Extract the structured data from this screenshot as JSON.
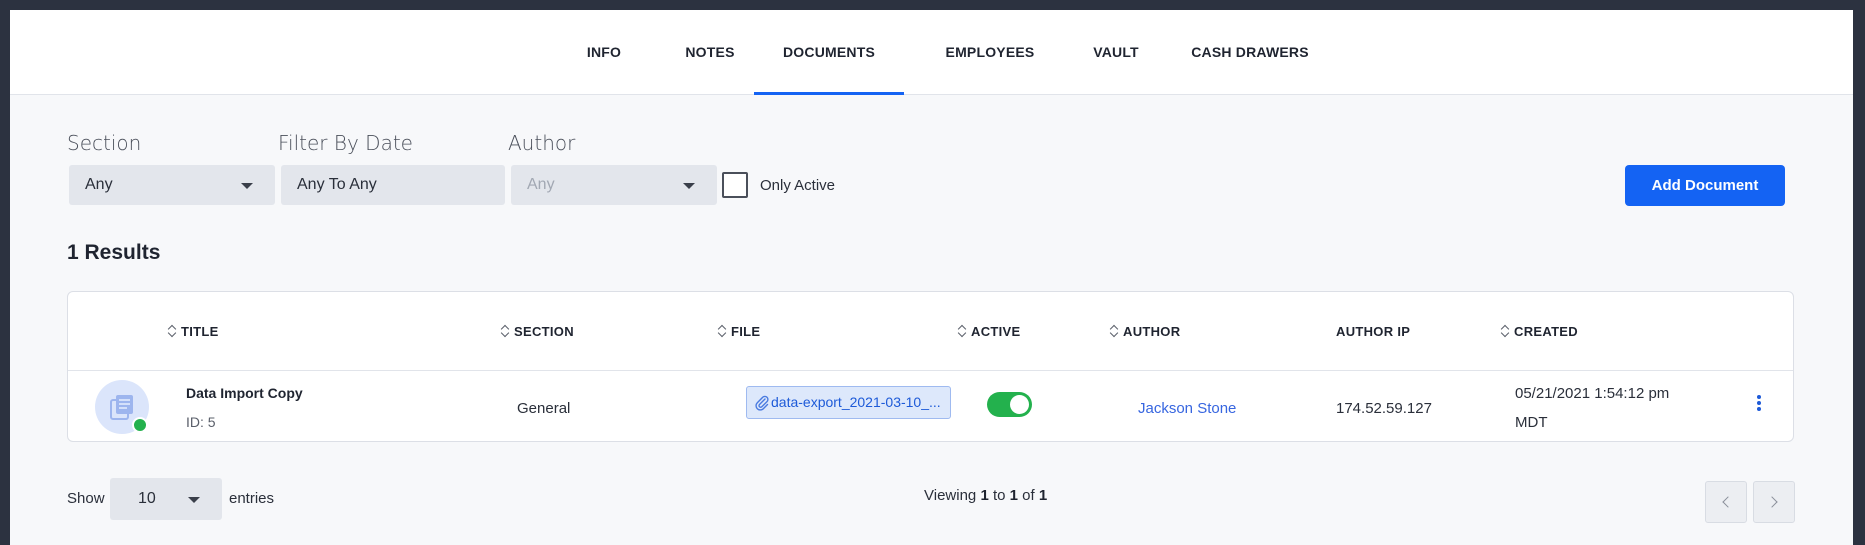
{
  "tabs": [
    {
      "label": "INFO",
      "active": false
    },
    {
      "label": "NOTES",
      "active": false
    },
    {
      "label": "DOCUMENTS",
      "active": true
    },
    {
      "label": "EMPLOYEES",
      "active": false
    },
    {
      "label": "VAULT",
      "active": false
    },
    {
      "label": "CASH DRAWERS",
      "active": false
    }
  ],
  "filters": {
    "section": {
      "label": "Section",
      "value": "Any"
    },
    "date": {
      "label": "Filter By Date",
      "value": "Any To Any"
    },
    "author": {
      "label": "Author",
      "value": "Any"
    },
    "only_active_label": "Only Active",
    "only_active_checked": false
  },
  "add_button_label": "Add Document",
  "results_label": "1 Results",
  "table": {
    "columns": [
      "TITLE",
      "SECTION",
      "FILE",
      "ACTIVE",
      "AUTHOR",
      "AUTHOR IP",
      "CREATED"
    ],
    "rows": [
      {
        "title": "Data Import Copy",
        "id": "ID: 5",
        "section": "General",
        "file": "data-export_2021-03-10_...",
        "active": true,
        "author": "Jackson Stone",
        "author_ip": "174.52.59.127",
        "created_line1": "05/21/2021 1:54:12 pm",
        "created_line2": "MDT"
      }
    ]
  },
  "footer": {
    "show_label": "Show",
    "page_size": "10",
    "entries_label": "entries",
    "viewing_prefix": "Viewing",
    "viewing_from": "1",
    "viewing_to_word": "to",
    "viewing_to": "1",
    "viewing_of_word": "of",
    "viewing_total": "1"
  },
  "colors": {
    "accent": "#1463f3",
    "status_online": "#23b14d",
    "link": "#3766e0"
  },
  "icons": [
    "document-stack-icon",
    "paperclip-icon",
    "kebab-menu-icon",
    "chevron-left-icon",
    "chevron-right-icon",
    "chevron-down-icon",
    "sort-icon"
  ]
}
